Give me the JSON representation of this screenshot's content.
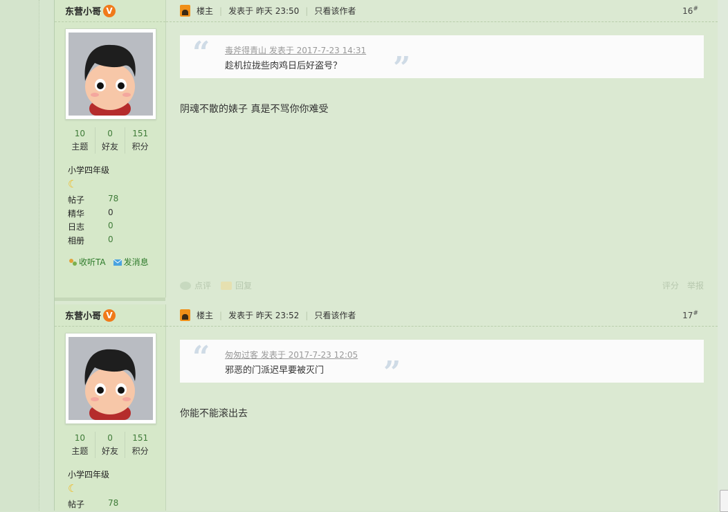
{
  "posts": [
    {
      "author": "东营小哥",
      "vip_badge": "V",
      "stats": [
        {
          "num": "10",
          "label": "主题"
        },
        {
          "num": "0",
          "label": "好友"
        },
        {
          "num": "151",
          "label": "积分"
        }
      ],
      "level": "小学四年级",
      "counts": [
        {
          "label": "帖子",
          "value": "78"
        },
        {
          "label": "精华",
          "value": "0"
        },
        {
          "label": "日志",
          "value": "0"
        },
        {
          "label": "相册",
          "value": "0"
        }
      ],
      "follow_label": "收听TA",
      "message_label": "发消息",
      "role": "楼主",
      "posted_at": "发表于 昨天 23:50",
      "only_author": "只看该作者",
      "floor_num": "16",
      "floor_mark": "#",
      "quote_meta": "毒斧得青山 发表于 2017-7-23 14:31",
      "quote_text": "趁机拉拢些肉鸡日后好盗号？",
      "body": "阴魂不散的婊子  真是不骂你你难受",
      "actions": {
        "comment": "点评",
        "reply": "回复",
        "rate": "评分",
        "report": "举报"
      }
    },
    {
      "author": "东营小哥",
      "vip_badge": "V",
      "stats": [
        {
          "num": "10",
          "label": "主题"
        },
        {
          "num": "0",
          "label": "好友"
        },
        {
          "num": "151",
          "label": "积分"
        }
      ],
      "level": "小学四年级",
      "counts": [
        {
          "label": "帖子",
          "value": "78"
        }
      ],
      "role": "楼主",
      "posted_at": "发表于 昨天 23:52",
      "only_author": "只看该作者",
      "floor_num": "17",
      "floor_mark": "#",
      "quote_meta": "匆匆过客 发表于 2017-7-23 12:05",
      "quote_text": "邪恶的门派迟早要被灭门",
      "body": "你能不能滚出去"
    }
  ]
}
